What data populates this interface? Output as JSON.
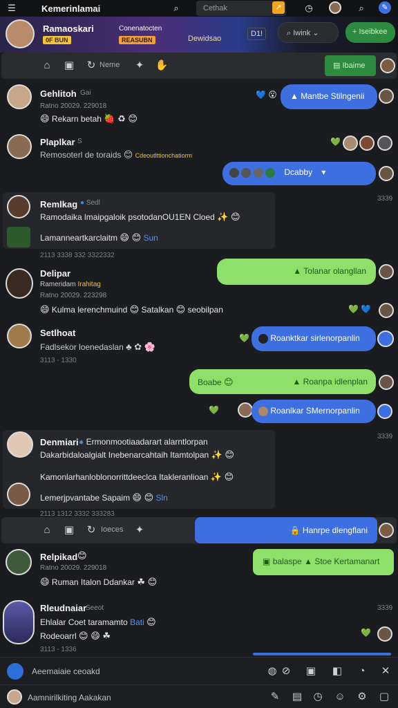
{
  "app": {
    "title": "Kemerinlamai"
  },
  "top_search": {
    "value": "Cethak",
    "btn": "↗"
  },
  "banner": {
    "name": "Ramaoskari",
    "tag1": "0F BUN",
    "tag2": "Conenatocten",
    "tag3": "REASUBN",
    "tag4": "Dewidsao",
    "code": "D1!",
    "search_label": "Iwink",
    "pill_label": "Iseibkee"
  },
  "nav1": {
    "label": "Neme",
    "button": "Ibaime"
  },
  "nav2": {
    "label": "Ioeces",
    "button": "Hanrpe dlengflani"
  },
  "messages": [
    {
      "name": "Gehlitoh",
      "tag": "Gai",
      "time": "Ratno 20029. 229018",
      "text": "Rekarn betah",
      "reply": "Mantbe Stilngenii"
    },
    {
      "name": "Plaplkar",
      "tag": "S",
      "text": "Remosoterl de toraids",
      "link": "Cdeoutlttionchatiorm",
      "reply": "Dcabby"
    },
    {
      "name": "Remlkag",
      "tag": "Sedl",
      "text": "Ramodaika lmaipgaloik psotodanOU1EN Cloed",
      "text2": "Lamanneartkarclaitm",
      "link": "Sun",
      "time": "2113 3338 332 3322332",
      "time_right": "3339"
    },
    {
      "name": "Delipar",
      "tag": "",
      "sub": "Rameridam",
      "sub_link": "Irahitag",
      "time": "Ratno 20029. 223298",
      "text": "Kulma lerenchmuind",
      "text2": "Satalkan",
      "text3": "seobilpan",
      "reply": "Tolanar olangllan"
    },
    {
      "name": "Setlhoat",
      "tag": "",
      "text": "Fadlsekor loenedaslan",
      "time": "3113 - 1330",
      "reply": "Roanktkar sirlenorpanlin"
    },
    {
      "name": "",
      "text": "Boabe",
      "reply": "Roanpa idlenplan"
    },
    {
      "name": "",
      "text": "",
      "reply": "Roanlkar SMernorpanlin"
    },
    {
      "name": "Denmiari",
      "tag": "Ermonmootiaadarart alarntlorpan",
      "text": "Dakarbidaloalgialt Inebenarcahtaih Itamtolpan",
      "text2": "Kamonlarhanloblonorrittdeeclca Itakleranlioan",
      "text3": "Lemerjpvantabe Sapaim",
      "link": "Sln",
      "time": "2113 1312 3332 333283",
      "time_right": "3339"
    },
    {
      "name": "Relpikad",
      "tag": "",
      "time": "Ratno 20029. 229018",
      "text": "Ruman Italon Ddankar",
      "reply": "balaspe",
      "reply2": "Stoe Kertamanart"
    },
    {
      "name": "Rleudnaiar",
      "tag": "Seeot",
      "text": "Ehlalar Coet taramamto",
      "link": "Bati",
      "text2": "Rodeoarrl",
      "time": "3113 - 1336",
      "time_right": "3339"
    }
  ],
  "bottom": {
    "compose": "Aeemaiaie ceoakd",
    "status": "Aamnirilkiting Aakakan"
  },
  "colors": {
    "blue": "#3d6fe0",
    "green": "#8ee06a",
    "bg": "#1b1c1f"
  }
}
